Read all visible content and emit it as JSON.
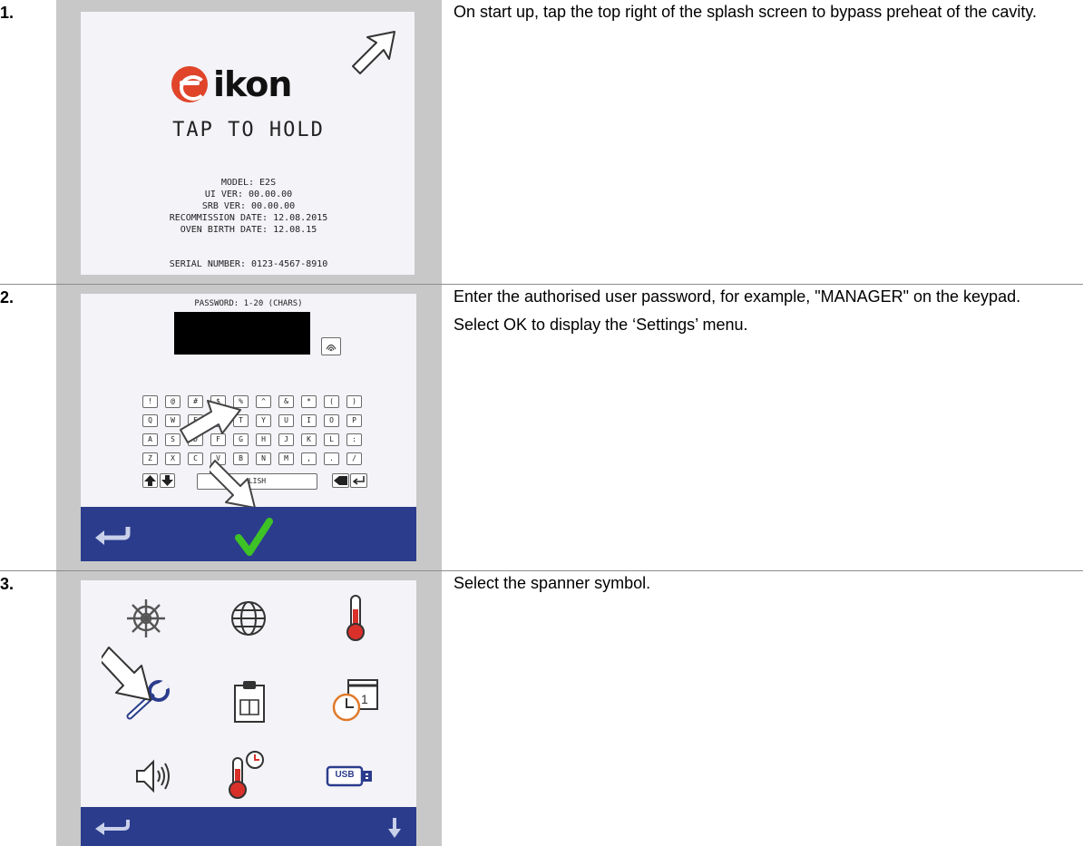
{
  "steps": [
    {
      "number": "1.",
      "text": [
        "On start up, tap the top right of the splash screen to bypass preheat of the cavity."
      ]
    },
    {
      "number": "2.",
      "text": [
        "Enter the authorised user password, for example, \"MANAGER\" on the keypad.",
        "Select OK to display the ‘Settings’ menu."
      ]
    },
    {
      "number": "3.",
      "text": [
        "Select the spanner symbol."
      ]
    }
  ],
  "splash": {
    "logo": "eikon",
    "tap_to_hold": "TAP TO HOLD",
    "model": "MODEL: E2S",
    "ui_ver": "UI VER: 00.00.00",
    "srb_ver": "SRB VER: 00.00.00",
    "recommission": "RECOMMISSION DATE: 12.08.2015",
    "birth": "OVEN BIRTH DATE: 12.08.15",
    "serial": "SERIAL NUMBER: 0123-4567-8910"
  },
  "password_screen": {
    "label": "PASSWORD: 1-20 (CHARS)",
    "keys_row1": [
      "!",
      "@",
      "#",
      "$",
      "%",
      "^",
      "&",
      "*",
      "(",
      ")"
    ],
    "keys_row2": [
      "Q",
      "W",
      "E",
      "R",
      "T",
      "Y",
      "U",
      "I",
      "O",
      "P"
    ],
    "keys_row3": [
      "A",
      "S",
      "D",
      "F",
      "G",
      "H",
      "J",
      "K",
      "L",
      ":"
    ],
    "keys_row4": [
      "Z",
      "X",
      "C",
      "V",
      "B",
      "N",
      "M",
      ",",
      ".",
      "/"
    ],
    "language_key": "LISH"
  },
  "settings_menu": {
    "icons": [
      "ships-wheel-icon",
      "globe-icon",
      "thermometer-icon",
      "spanner-icon",
      "clipboard-book-icon",
      "clock-calendar-icon",
      "speaker-icon",
      "thermometer-clock-icon",
      "usb-icon"
    ],
    "usb_label": "USB"
  },
  "colors": {
    "blue_bar": "#2b3c8c",
    "frame_gray": "#c8c8c8",
    "logo_orange": "#e0452a",
    "thermometer_red": "#d9302a",
    "check_green": "#3ec326"
  }
}
